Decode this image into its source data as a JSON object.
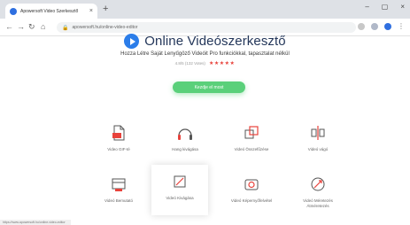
{
  "browser": {
    "tab_title": "Apowersoft Video Szerkesztő",
    "tab_close": "×",
    "new_tab": "+",
    "window_controls": [
      "–",
      "▢",
      "×"
    ],
    "url": "apowersoft.hu/online-video-editor",
    "lock": "🔒"
  },
  "hero": {
    "title": "Online Videószerkesztő",
    "subtitle": "Hozza Létre Saját Lenyűgöző Videóit Pro funkciókkal, tapasztalat nélkül",
    "rating_text": "4.8/5 (132 Votes)",
    "stars": "★★★★★",
    "cta_label": "Kezdje el most"
  },
  "tools": [
    {
      "label": "Video GIF-té",
      "icon": "gif-file-icon"
    },
    {
      "label": "Hang kivágása",
      "icon": "headphones-icon"
    },
    {
      "label": "Videó Összefűzése",
      "icon": "merge-icon"
    },
    {
      "label": "Videó vágó",
      "icon": "split-icon"
    },
    {
      "label": "Videó Bemutató",
      "icon": "film-icon"
    },
    {
      "label": "Videó Kivágása",
      "icon": "crop-icon"
    },
    {
      "label": "Videó Képernyőfelvétel",
      "icon": "camera-icon"
    },
    {
      "label": "Videó Méretezés Átméretezés",
      "icon": "resize-icon"
    }
  ],
  "status": "https://www.apowersoft.hu/online-video-editor",
  "colors": {
    "accent": "#e8423b",
    "cta": "#5ad07a",
    "brand": "#2b7de9",
    "title": "#24375a"
  }
}
